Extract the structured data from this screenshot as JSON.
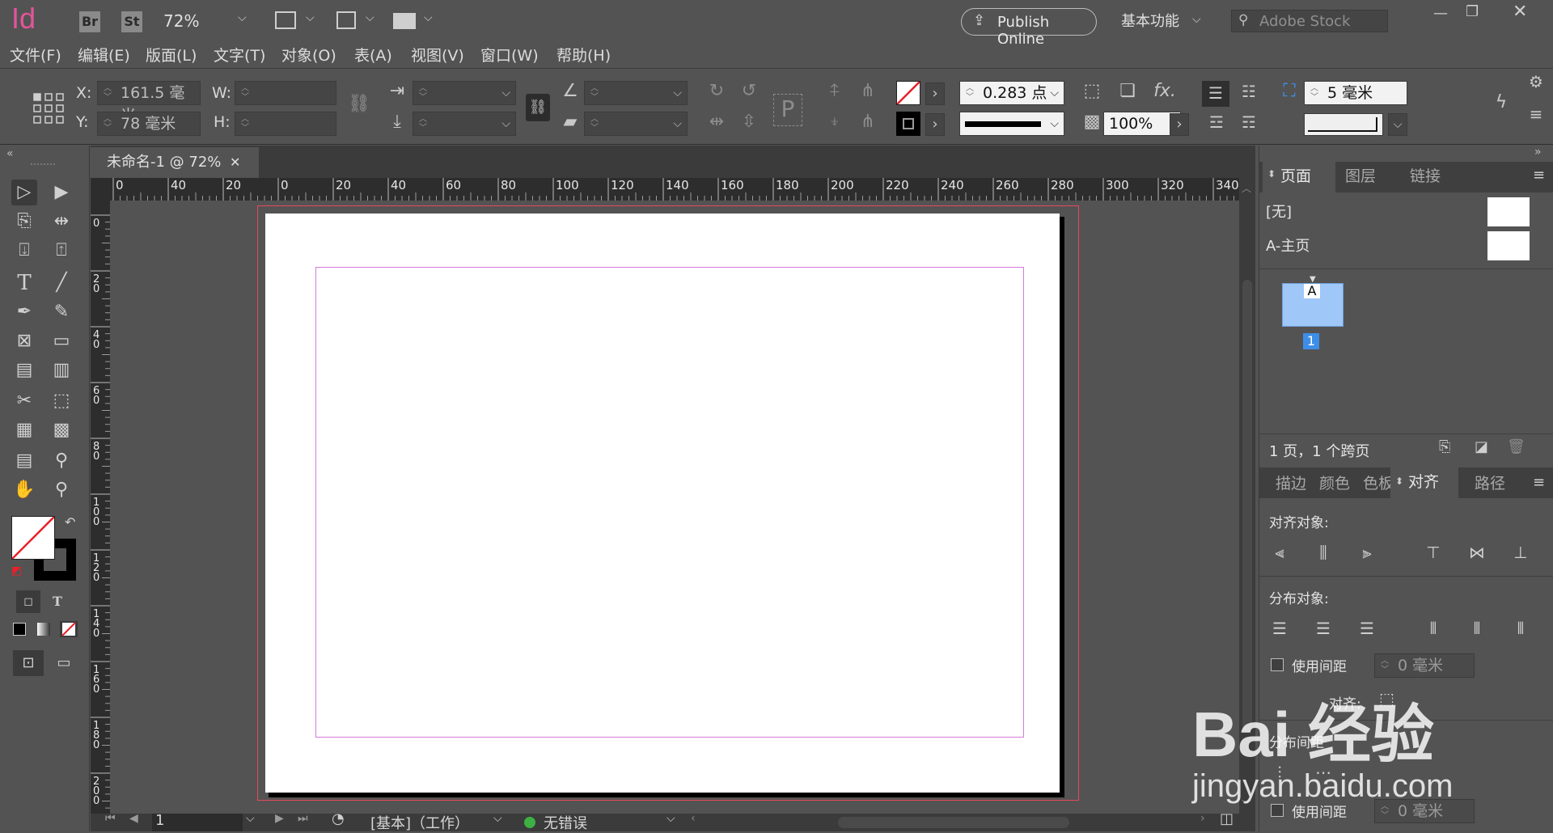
{
  "app": {
    "logo": "Id",
    "bridge": "Br",
    "stock": "St",
    "zoom": "72%",
    "publish_label": "Publish Online",
    "workspace": "基本功能",
    "search_placeholder": "Adobe Stock"
  },
  "menu": [
    "文件(F)",
    "编辑(E)",
    "版面(L)",
    "文字(T)",
    "对象(O)",
    "表(A)",
    "视图(V)",
    "窗口(W)",
    "帮助(H)"
  ],
  "control": {
    "x_label": "X:",
    "x_value": "161.5 毫米",
    "y_label": "Y:",
    "y_value": "78 毫米",
    "w_label": "W:",
    "h_label": "H:",
    "stroke_weight": "0.283 点",
    "opacity": "100%",
    "gap": "5 毫米"
  },
  "document": {
    "tab_title": "未命名-1 @ 72%",
    "h_ruler_labels": [
      "0",
      "40",
      "20",
      "0",
      "20",
      "40",
      "60",
      "80",
      "100",
      "120",
      "140",
      "160",
      "180",
      "200",
      "220",
      "240",
      "260",
      "280",
      "300",
      "320",
      "340"
    ],
    "v_ruler_labels": [
      "0",
      "2 0",
      "4 0",
      "6 0",
      "8 0",
      "1 0 0",
      "1 2 0",
      "1 4 0",
      "1 6 0",
      "1 8 0",
      "2 0 0"
    ]
  },
  "status": {
    "page": "1",
    "profile": "[基本]（工作）",
    "preflight": "无错误",
    "preflight_color": "#3cb043"
  },
  "pages_panel": {
    "tabs": [
      "页面",
      "图层",
      "链接"
    ],
    "none_master": "[无]",
    "a_master": "A-主页",
    "page_prefix": "A",
    "page_number": "1",
    "summary": "1 页，1 个跨页"
  },
  "align_panel": {
    "tabs": [
      "描边",
      "颜色",
      "色板",
      "对齐",
      "路径"
    ],
    "align_objects": "对齐对象:",
    "distribute_objects": "分布对象:",
    "use_spacing": "使用间距",
    "spacing_value": "0 毫米",
    "align_to": "对齐:",
    "distribute_spacing": "分布间距",
    "use_spacing2": "使用间距",
    "spacing_value2": "0 毫米"
  },
  "watermark": {
    "brand": "Bai 经验",
    "url": "jingyan.baidu.com"
  },
  "colors": {
    "accent": "#e3559a",
    "bleed": "#e8495c",
    "margin": "#d67bd8",
    "page_thumb": "#9fc7f7"
  }
}
